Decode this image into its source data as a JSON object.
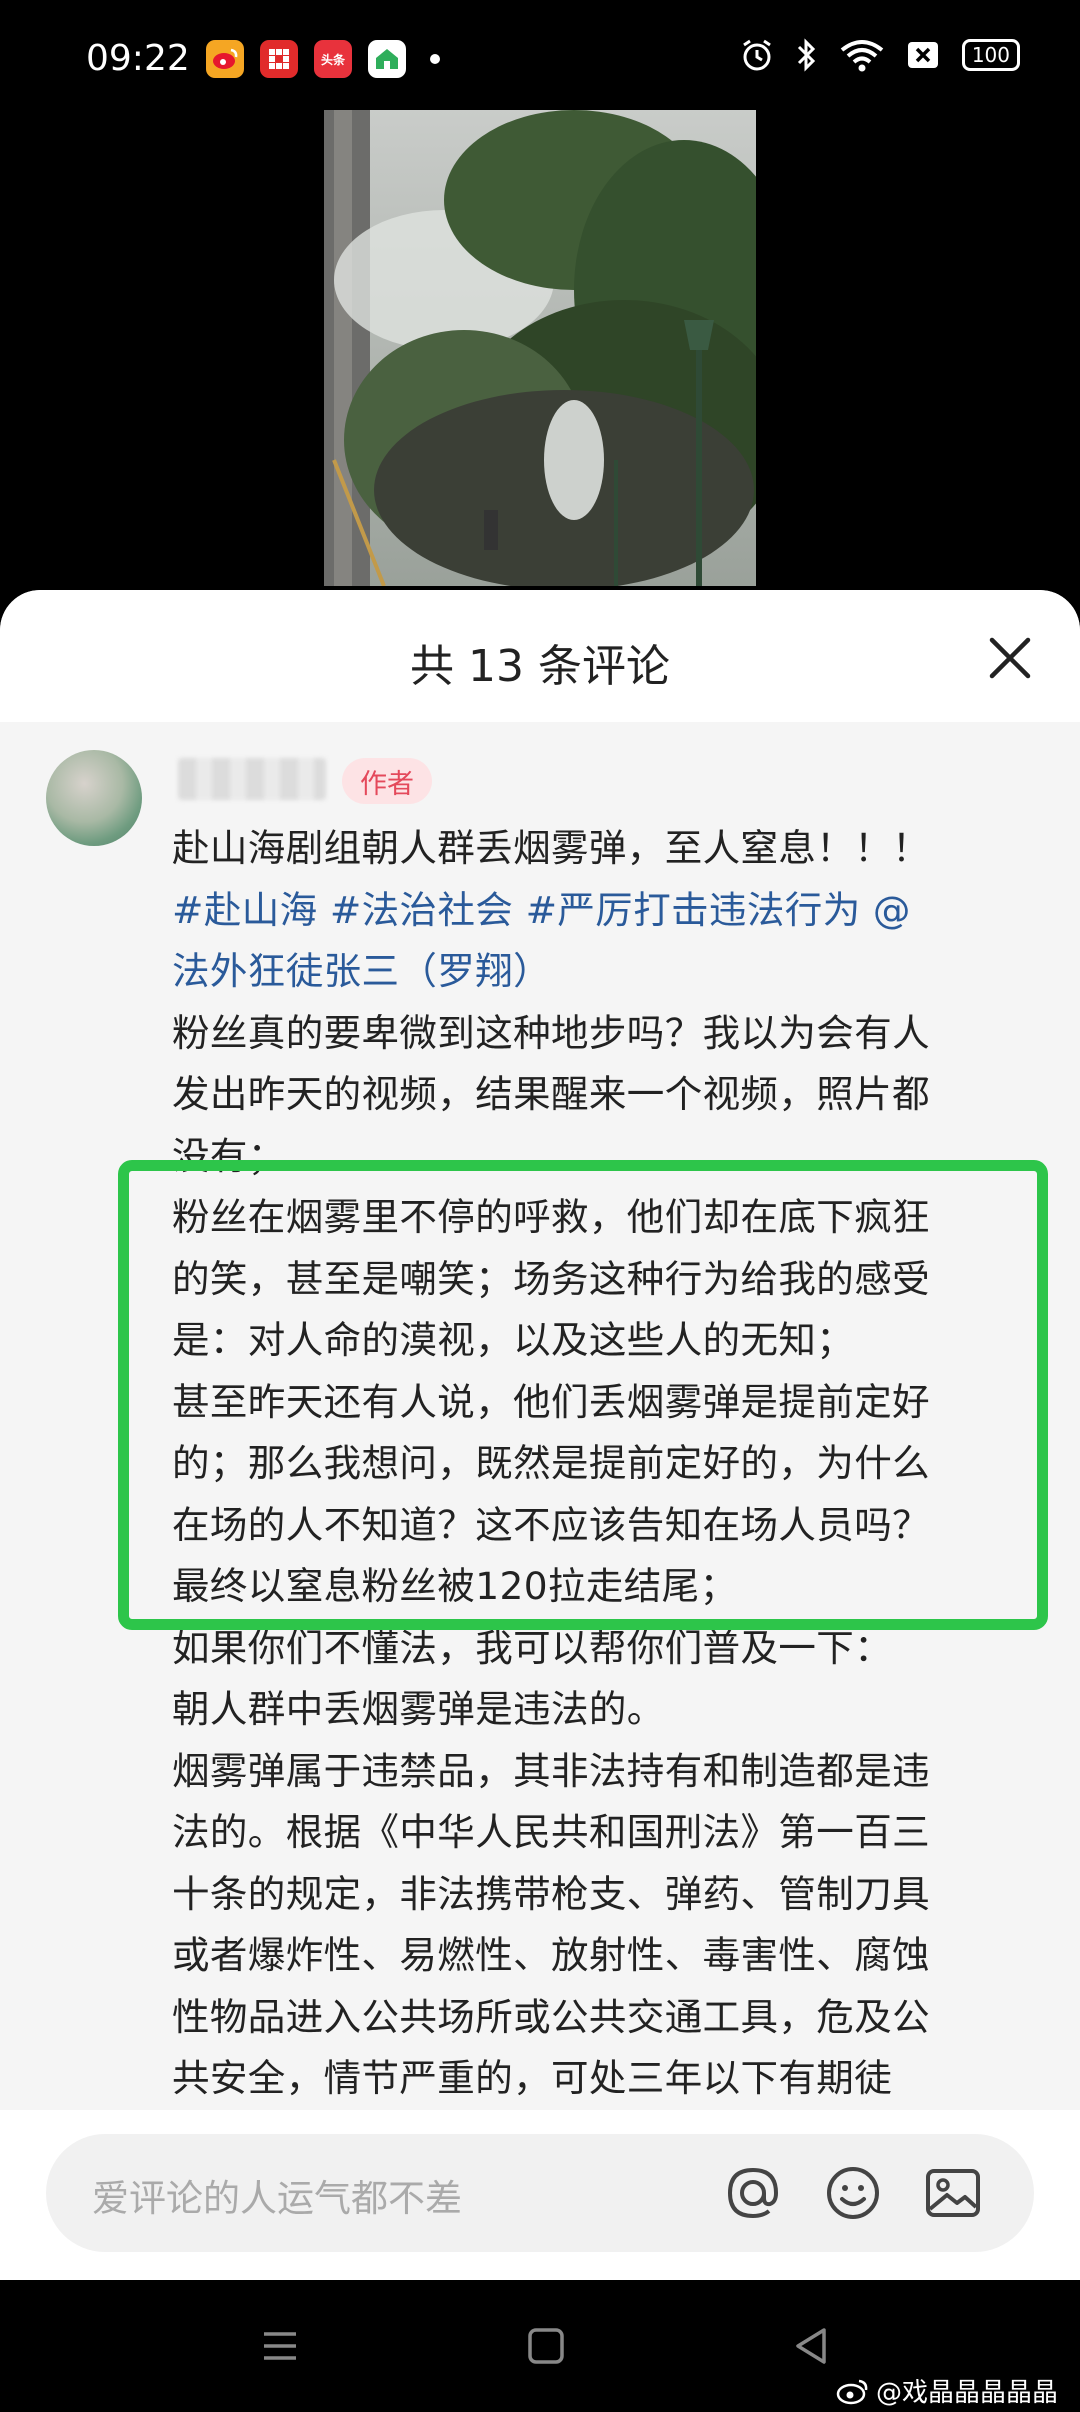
{
  "status_bar": {
    "time": "09:22",
    "battery": "100",
    "app_icons": [
      "weibo-icon",
      "app-red-icon",
      "toutiao-icon",
      "home-app-icon"
    ],
    "toutiao_label": "头条"
  },
  "comments_panel": {
    "title": "共 13 条评论",
    "author_badge": "作者",
    "comment_lines": [
      "赴山海剧组朝人群丢烟雾弹，至人窒息！！！",
      "#赴山海 #法治社会 #严厉打击违法行为 @",
      "法外狂徒张三（罗翔）",
      "粉丝真的要卑微到这种地步吗？我以为会有人",
      "发出昨天的视频，结果醒来一个视频，照片都",
      "没有；",
      "粉丝在烟雾里不停的呼救，他们却在底下疯狂",
      "的笑，甚至是嘲笑；场务这种行为给我的感受",
      "是：对人命的漠视，以及这些人的无知；",
      "甚至昨天还有人说，他们丢烟雾弹是提前定好",
      "的；那么我想问，既然是提前定好的，为什么",
      "在场的人不知道？这不应该告知在场人员吗？",
      "最终以窒息粉丝被120拉走结尾；",
      "如果你们不懂法，我可以帮你们普及一下：",
      "朝人群中丢烟雾弹是违法的。",
      "烟雾弹属于违禁品，其非法持有和制造都是违",
      "法的。根据《中华人民共和国刑法》第一百三",
      "十条的规定，非法携带枪支、弹药、管制刀具",
      "或者爆炸性、易燃性、放射性、毒害性、腐蚀",
      "性物品进入公共场所或公共交通工具，危及公",
      "共安全，情节严重的，可处三年以下有期徒"
    ]
  },
  "input": {
    "placeholder": "爱评论的人运气都不差"
  },
  "watermark": "@戏晶晶晶晶晶",
  "colors": {
    "highlight": "#2dc54a",
    "link": "#2a5a9a",
    "badge_bg": "#fde3e5",
    "badge_text": "#e4495b"
  }
}
